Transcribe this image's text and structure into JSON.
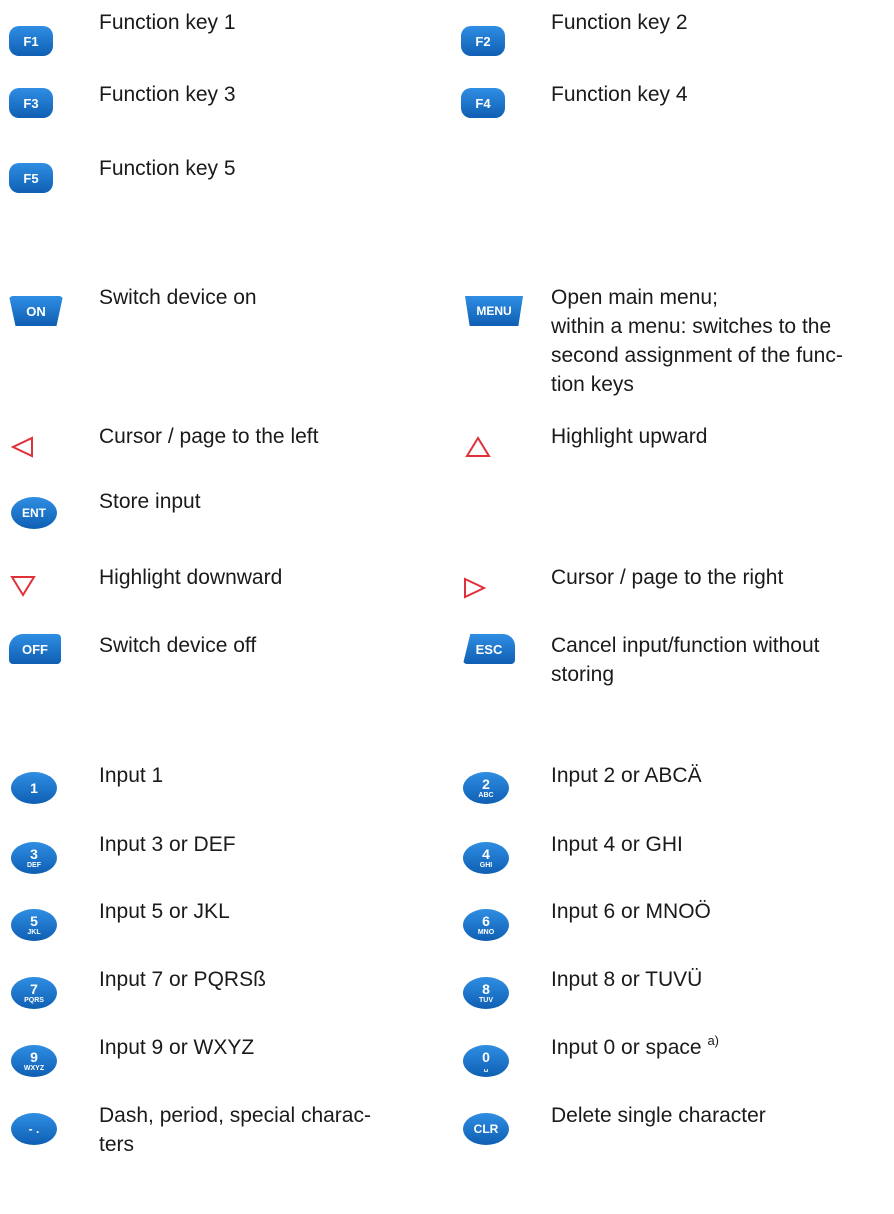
{
  "keys": {
    "f1": {
      "label": "F1",
      "desc": "Function key 1"
    },
    "f2": {
      "label": "F2",
      "desc": "Function key 2"
    },
    "f3": {
      "label": "F3",
      "desc": "Function key 3"
    },
    "f4": {
      "label": "F4",
      "desc": "Function key 4"
    },
    "f5": {
      "label": "F5",
      "desc": "Function key 5"
    },
    "on": {
      "label": "ON",
      "desc": "Switch device on"
    },
    "menu": {
      "label": "MENU",
      "desc_lines": [
        "Open main menu;",
        "within a menu: switches to the",
        "second assignment of the func-",
        "tion keys"
      ]
    },
    "left": {
      "icon": "triangle-left-icon",
      "desc": "Cursor / page to the left"
    },
    "up": {
      "icon": "triangle-up-icon",
      "desc": "Highlight upward"
    },
    "ent": {
      "label": "ENT",
      "desc": "Store input"
    },
    "down": {
      "icon": "triangle-down-icon",
      "desc": "Highlight downward"
    },
    "right": {
      "icon": "triangle-right-icon",
      "desc": "Cursor / page to the right"
    },
    "off": {
      "label": "OFF",
      "desc": "Switch device off"
    },
    "esc": {
      "label": "ESC",
      "desc_lines": [
        "Cancel input/function without",
        "storing"
      ]
    },
    "k1": {
      "digit": "1",
      "letters": "",
      "desc": "Input 1"
    },
    "k2": {
      "digit": "2",
      "letters": "ABC",
      "desc": "Input 2 or ABCÄ"
    },
    "k3": {
      "digit": "3",
      "letters": "DEF",
      "desc": "Input 3 or DEF"
    },
    "k4": {
      "digit": "4",
      "letters": "GHI",
      "desc": "Input 4 or GHI"
    },
    "k5": {
      "digit": "5",
      "letters": "JKL",
      "desc": "Input 5 or JKL"
    },
    "k6": {
      "digit": "6",
      "letters": "MNO",
      "desc": "Input 6 or MNOÖ"
    },
    "k7": {
      "digit": "7",
      "letters": "PQRS",
      "desc": "Input 7 or PQRSß"
    },
    "k8": {
      "digit": "8",
      "letters": "TUV",
      "desc": "Input 8 or TUVÜ"
    },
    "k9": {
      "digit": "9",
      "letters": "WXYZ",
      "desc": "Input 9 or WXYZ"
    },
    "k0": {
      "digit": "0",
      "letters": "␣",
      "desc": "Input 0 or space",
      "footnote": "a)"
    },
    "dash": {
      "label": "- .",
      "desc_lines": [
        "Dash, period, special charac-",
        "ters"
      ]
    },
    "clr": {
      "label": "CLR",
      "desc": "Delete single character"
    }
  },
  "colors": {
    "key_blue": "#1a74cf",
    "arrow_red": "#e0303a"
  }
}
